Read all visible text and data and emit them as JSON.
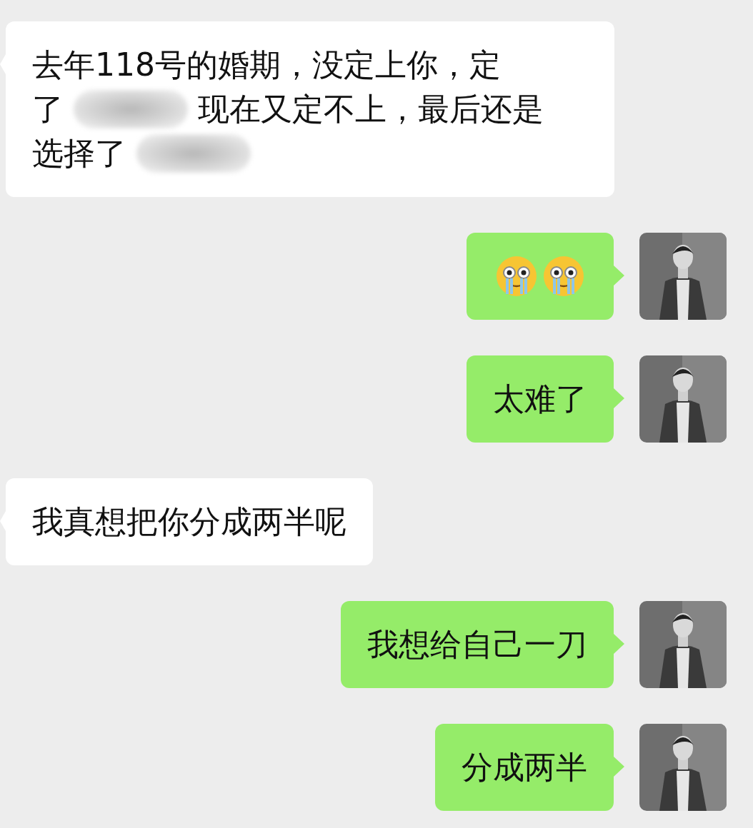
{
  "messages": [
    {
      "sent": false,
      "lines": [
        [
          {
            "kind": "text",
            "text": "去年118号的婚期，没定上你，定"
          }
        ],
        [
          {
            "kind": "text",
            "text": "了"
          },
          {
            "kind": "redacted"
          },
          {
            "kind": "text",
            "text": "现在又定不上，最后还是"
          }
        ],
        [
          {
            "kind": "text",
            "text": "选择了"
          },
          {
            "kind": "redacted"
          }
        ]
      ]
    },
    {
      "sent": true,
      "lines": [
        [
          {
            "kind": "emoji"
          },
          {
            "kind": "emoji"
          }
        ]
      ]
    },
    {
      "sent": true,
      "lines": [
        [
          {
            "kind": "text",
            "text": "太难了"
          }
        ]
      ]
    },
    {
      "sent": false,
      "lines": [
        [
          {
            "kind": "text",
            "text": "我真想把你分成两半呢"
          }
        ]
      ]
    },
    {
      "sent": true,
      "lines": [
        [
          {
            "kind": "text",
            "text": "我想给自己一刀"
          }
        ]
      ]
    },
    {
      "sent": true,
      "lines": [
        [
          {
            "kind": "text",
            "text": "分成两半"
          }
        ]
      ]
    }
  ]
}
